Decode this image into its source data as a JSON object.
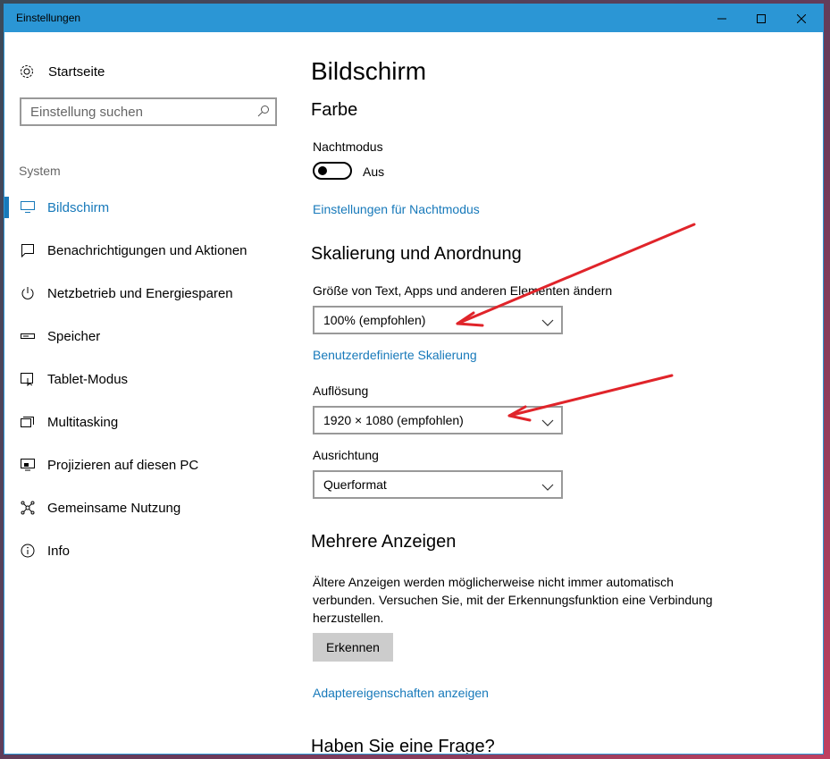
{
  "window": {
    "title": "Einstellungen"
  },
  "sidebar": {
    "home_label": "Startseite",
    "search_placeholder": "Einstellung suchen",
    "section": "System",
    "items": [
      {
        "label": "Bildschirm",
        "icon": "monitor-icon",
        "active": true
      },
      {
        "label": "Benachrichtigungen und Aktionen",
        "icon": "notification-icon"
      },
      {
        "label": "Netzbetrieb und Energiesparen",
        "icon": "power-icon"
      },
      {
        "label": "Speicher",
        "icon": "storage-icon"
      },
      {
        "label": "Tablet-Modus",
        "icon": "tablet-icon"
      },
      {
        "label": "Multitasking",
        "icon": "multitasking-icon"
      },
      {
        "label": "Projizieren auf diesen PC",
        "icon": "project-icon"
      },
      {
        "label": "Gemeinsame Nutzung",
        "icon": "share-icon"
      },
      {
        "label": "Info",
        "icon": "info-icon"
      }
    ]
  },
  "main": {
    "title": "Bildschirm",
    "color_heading": "Farbe",
    "night_label": "Nachtmodus",
    "night_state": "Aus",
    "night_link": "Einstellungen für Nachtmodus",
    "scaling_heading": "Skalierung und Anordnung",
    "size_label": "Größe von Text, Apps und anderen Elementen ändern",
    "size_value": "100% (empfohlen)",
    "custom_scaling_link": "Benutzerdefinierte Skalierung",
    "resolution_label": "Auflösung",
    "resolution_value": "1920 × 1080 (empfohlen)",
    "orientation_label": "Ausrichtung",
    "orientation_value": "Querformat",
    "multi_heading": "Mehrere Anzeigen",
    "multi_text": "Ältere Anzeigen werden möglicherweise nicht immer automatisch verbunden. Versuchen Sie, mit der Erkennungsfunktion eine Verbindung herzustellen.",
    "detect_button": "Erkennen",
    "adapter_link": "Adaptereigenschaften anzeigen",
    "question_heading": "Haben Sie eine Frage?"
  },
  "colors": {
    "accent": "#1779ba",
    "titlebar": "#2b96d5",
    "annotation": "#e0242a"
  }
}
